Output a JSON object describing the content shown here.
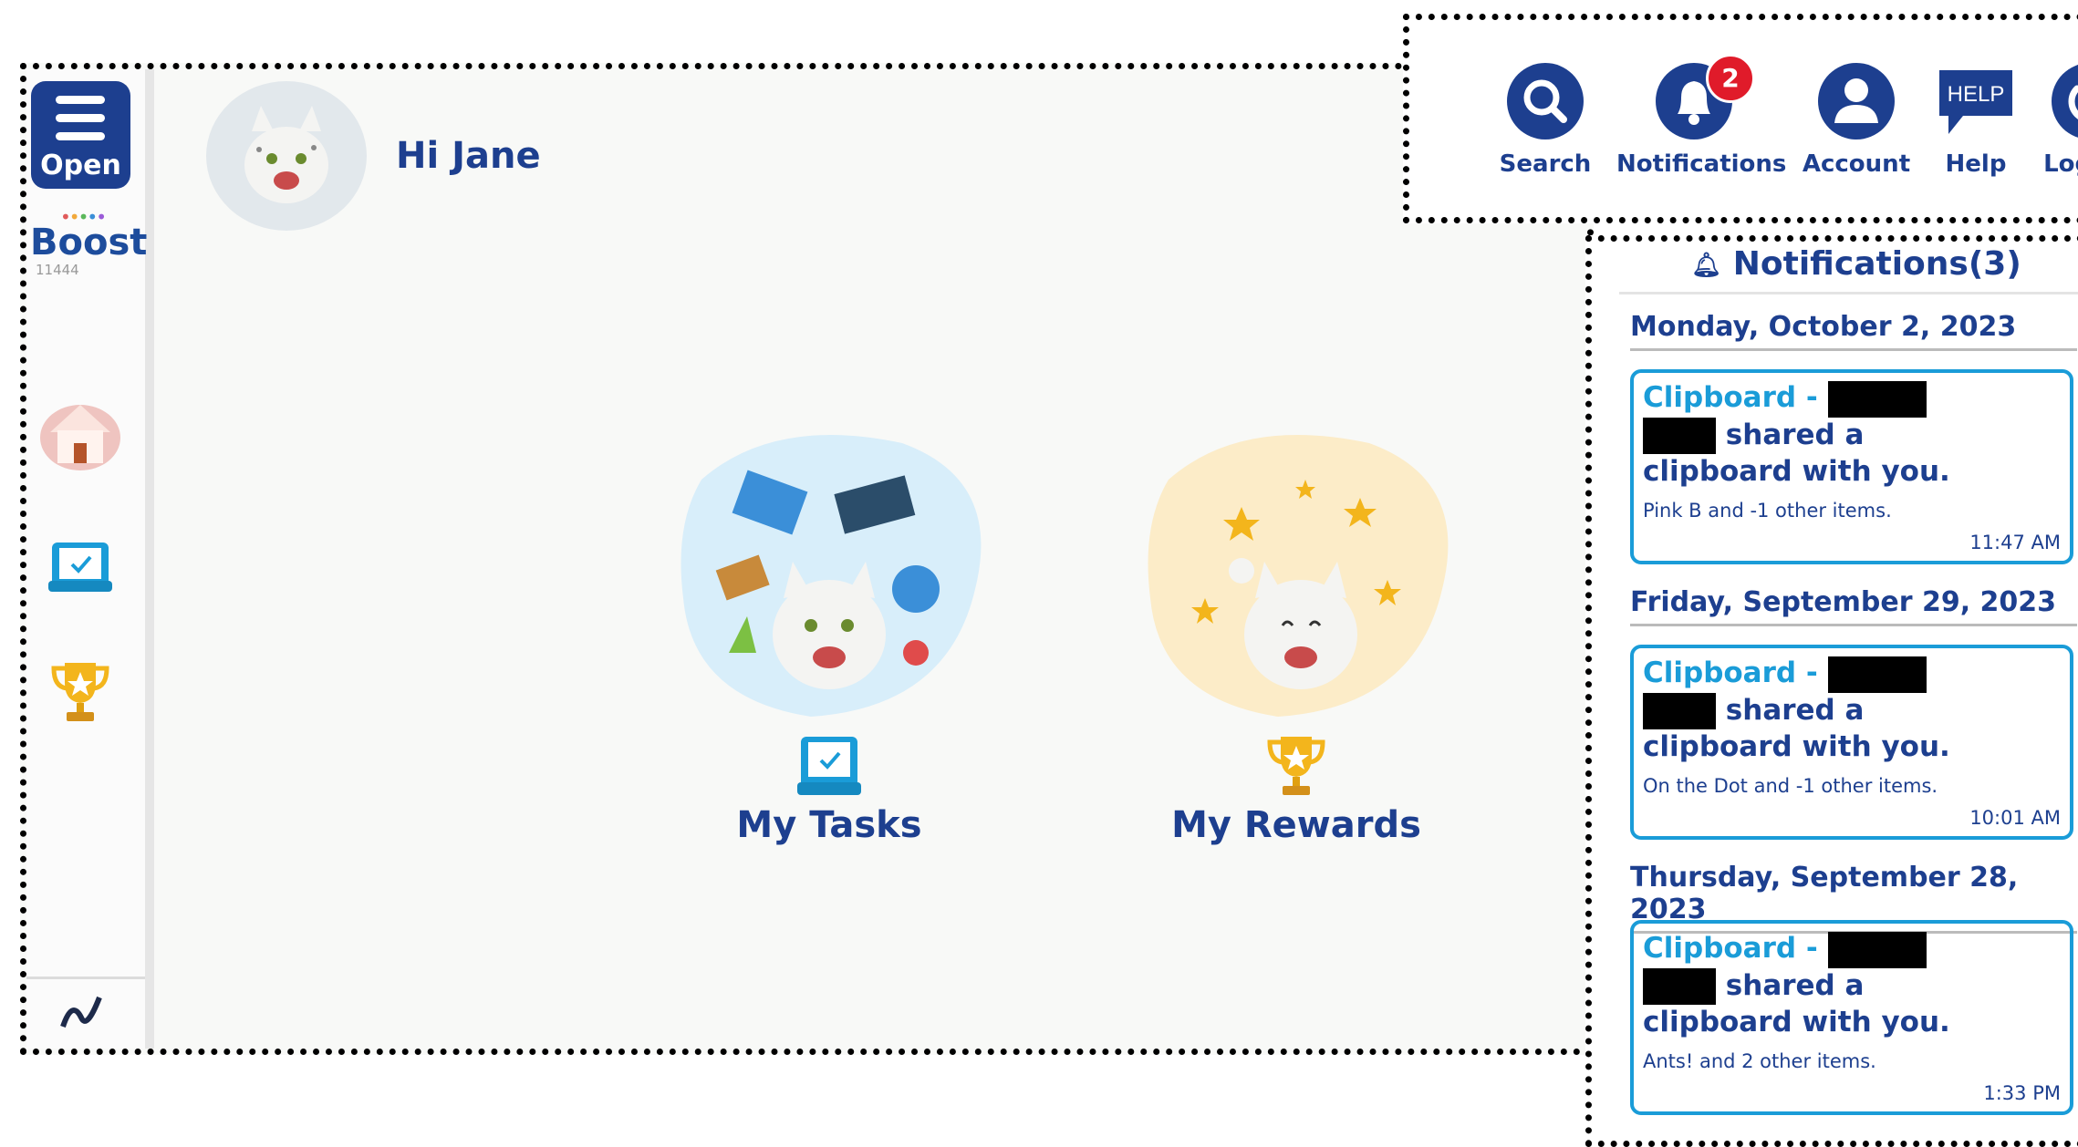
{
  "sidebar": {
    "open_label": "Open",
    "logo_text": "Boost",
    "org_id": "11444",
    "nav": [
      {
        "name": "home"
      },
      {
        "name": "tasks"
      },
      {
        "name": "rewards"
      }
    ]
  },
  "header": {
    "greeting": "Hi Jane"
  },
  "cards": [
    {
      "title": "My Tasks"
    },
    {
      "title": "My Rewards"
    }
  ],
  "toolbar": {
    "search_label": "Search",
    "notifications_label": "Notifications",
    "notifications_count": "2",
    "account_label": "Account",
    "help_label": "Help",
    "help_icon_text": "HELP",
    "logout_label": "Logout"
  },
  "notifications": {
    "title": "Notifications(3)",
    "groups": [
      {
        "date": "Monday, October 2, 2023",
        "item": {
          "prefix": "Clipboard - ",
          "line2": " shared a",
          "line3": "clipboard with you.",
          "detail": "Pink B and -1 other items.",
          "time": "11:47 AM"
        }
      },
      {
        "date": "Friday, September 29, 2023",
        "item": {
          "prefix": "Clipboard - ",
          "line2": " shared a",
          "line3": "clipboard with you.",
          "detail": "On the Dot and -1 other items.",
          "time": "10:01 AM"
        }
      },
      {
        "date": "Thursday, September 28, 2023",
        "item": {
          "prefix": "Clipboard - ",
          "line2": " shared a",
          "line3": "clipboard with you.",
          "detail": "Ants! and 2 other items.",
          "time": "1:33 PM"
        }
      }
    ]
  },
  "colors": {
    "primary": "#1d3f8f",
    "accent": "#1a9cd8",
    "badge": "#e01b2a",
    "tasks_blob": "#d8eefa",
    "rewards_blob": "#fcecc8"
  }
}
